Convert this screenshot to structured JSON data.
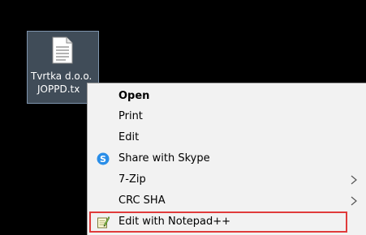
{
  "desktop": {
    "file": {
      "label_line1": "Tvrtka d.o.o.",
      "label_line2": "JOPPD.tx",
      "icon": "text-file-icon"
    }
  },
  "context_menu": {
    "items": [
      {
        "label": "Open",
        "bold": true,
        "icon": null,
        "submenu": false
      },
      {
        "label": "Print",
        "bold": false,
        "icon": null,
        "submenu": false
      },
      {
        "label": "Edit",
        "bold": false,
        "icon": null,
        "submenu": false
      },
      {
        "label": "Share with Skype",
        "bold": false,
        "icon": "skype-icon",
        "submenu": false
      },
      {
        "label": "7-Zip",
        "bold": false,
        "icon": null,
        "submenu": true
      },
      {
        "label": "CRC SHA",
        "bold": false,
        "icon": null,
        "submenu": true
      },
      {
        "label": "Edit with Notepad++",
        "bold": false,
        "icon": "notepad-plus-plus-icon",
        "submenu": false,
        "highlighted": true
      }
    ]
  },
  "colors": {
    "desktop_bg": "#000000",
    "menu_bg": "#f2f2f2",
    "highlight_border": "#e03b3b",
    "skype_blue": "#2a8ee8",
    "selection_bg": "#99b4d1"
  }
}
